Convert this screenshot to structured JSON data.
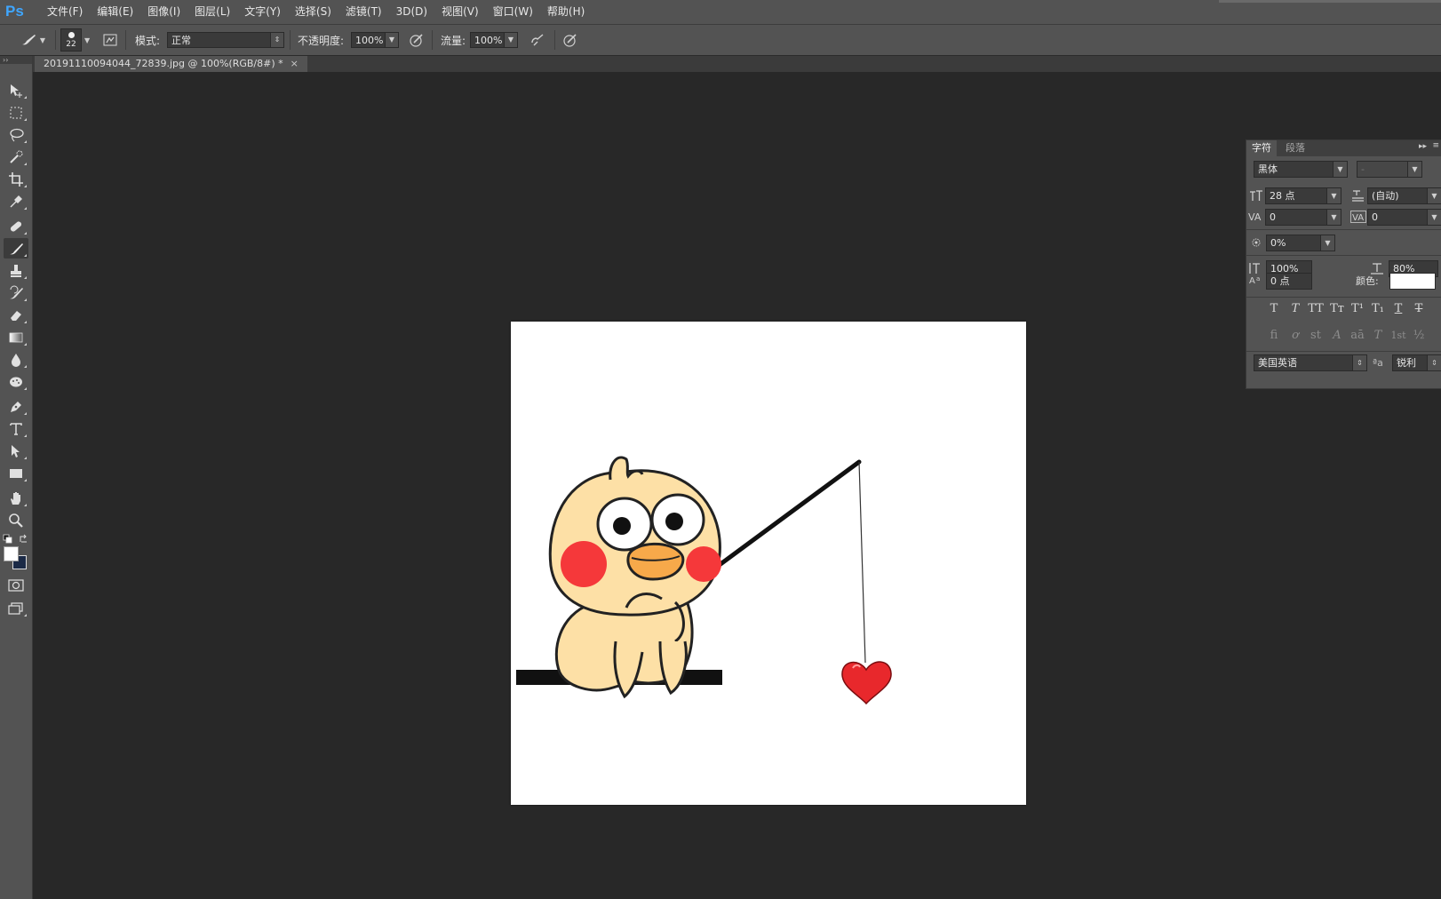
{
  "app": {
    "logo": "Ps"
  },
  "menu": [
    {
      "label": "文件(F)"
    },
    {
      "label": "编辑(E)"
    },
    {
      "label": "图像(I)"
    },
    {
      "label": "图层(L)"
    },
    {
      "label": "文字(Y)"
    },
    {
      "label": "选择(S)"
    },
    {
      "label": "滤镜(T)"
    },
    {
      "label": "3D(D)"
    },
    {
      "label": "视图(V)"
    },
    {
      "label": "窗口(W)"
    },
    {
      "label": "帮助(H)"
    }
  ],
  "options": {
    "brush_size": "22",
    "mode_label": "模式:",
    "mode_value": "正常",
    "opacity_label": "不透明度:",
    "opacity_value": "100%",
    "flow_label": "流量:",
    "flow_value": "100%"
  },
  "document": {
    "tab_title": "20191110094044_72839.jpg @ 100%(RGB/8#) *",
    "close_glyph": "×"
  },
  "tools": {
    "foreground_color": "#ffffff",
    "background_color": "#1b2a46"
  },
  "char_panel": {
    "tab_character": "字符",
    "tab_paragraph": "段落",
    "font_family": "黑体",
    "font_style": "-",
    "font_size": "28 点",
    "leading": "(自动)",
    "kerning": "0",
    "tracking": "0",
    "tsume": "0%",
    "vertical_scale": "100%",
    "horizontal_scale": "80%",
    "baseline_shift": "0 点",
    "color_label": "颜色:",
    "color_value": "#ffffff",
    "language": "美国英语",
    "aa_label": "ªa",
    "antialias": "锐利",
    "style_buttons": [
      "T",
      "T",
      "TT",
      "Tт",
      "T¹",
      "T₁",
      "T",
      "T"
    ],
    "opentype_buttons": [
      "ﬁ",
      "ơ",
      "st",
      "A",
      "aā",
      "T",
      "1st",
      "½"
    ]
  }
}
